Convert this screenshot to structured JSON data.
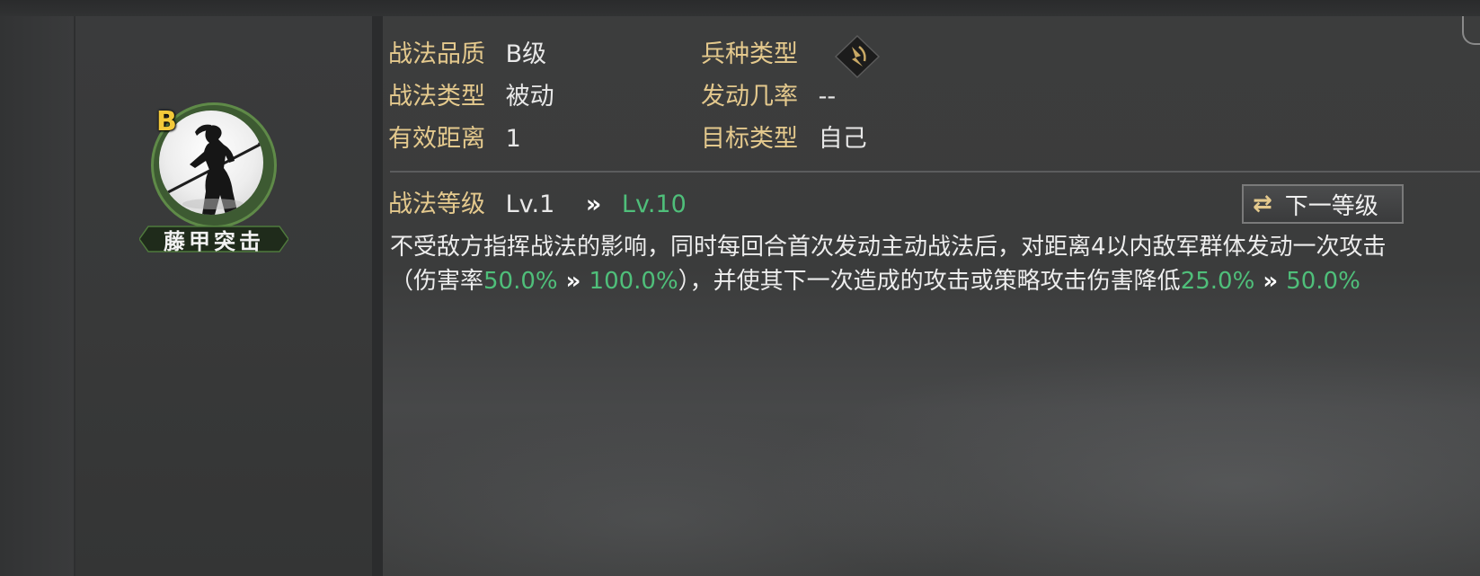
{
  "skill": {
    "grade_letter": "B",
    "name": "藤甲突击",
    "ring_color": "#5f8a48",
    "grade_color": "#f3c93a"
  },
  "attributes": {
    "quality_label": "战法品质",
    "quality_value": "B级",
    "type_label": "战法类型",
    "type_value": "被动",
    "range_label": "有效距离",
    "range_value": "1",
    "troop_label": "兵种类型",
    "troop_icon": "troop-type-icon",
    "trigger_label": "发动几率",
    "trigger_value": "--",
    "target_label": "目标类型",
    "target_value": "自己"
  },
  "level": {
    "label": "战法等级",
    "current": "Lv.1",
    "arrow": "»",
    "max": "Lv.10",
    "next_button": "下一等级",
    "next_button_icon": "swap-icon"
  },
  "description": {
    "part1": "不受敌方指挥战法的影响，同时每回合首次发动主动战法后，对距离4以内敌军群体发动一次攻击（伤害率",
    "dmg_from": "50.0%",
    "arrow1": " » ",
    "dmg_to": "100.0%",
    "part2": "），并使其下一次造成的攻击或策略攻击伤害降低",
    "reduce_from": "25.0%",
    "arrow2": " » ",
    "reduce_to": "50.0%"
  },
  "colors": {
    "label_gold": "#e4c98d",
    "highlight_green": "#4fbf7a",
    "text_white": "#e8e8e8"
  }
}
